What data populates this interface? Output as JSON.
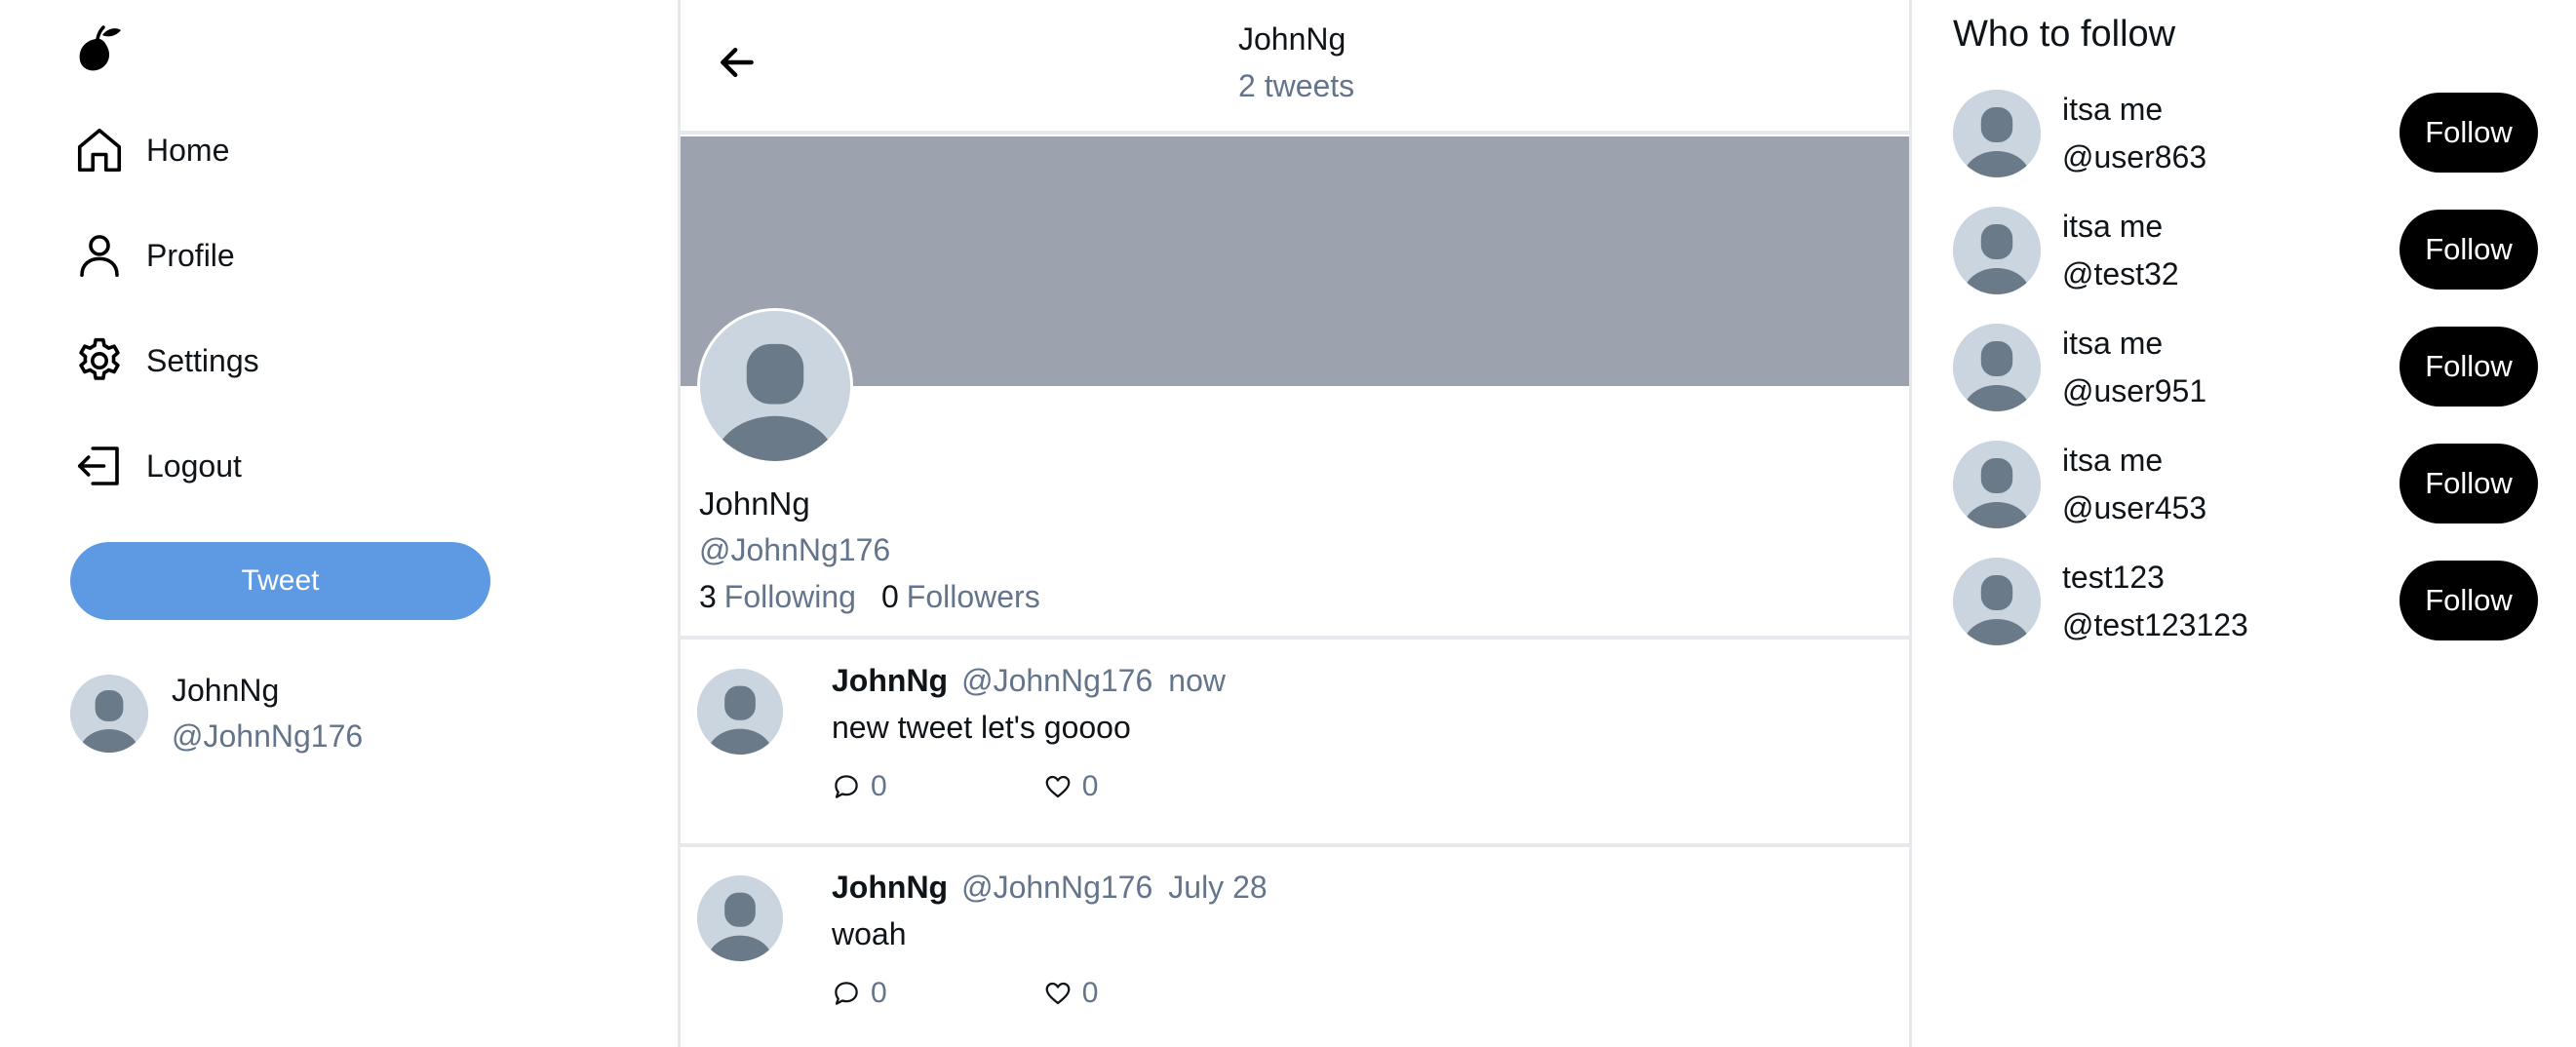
{
  "sidebar": {
    "logo_icon": "pear-logo-icon",
    "nav": [
      {
        "label": "Home",
        "icon": "home-icon"
      },
      {
        "label": "Profile",
        "icon": "user-icon"
      },
      {
        "label": "Settings",
        "icon": "gear-icon"
      },
      {
        "label": "Logout",
        "icon": "logout-icon"
      }
    ],
    "tweet_button": "Tweet",
    "current_user": {
      "name": "JohnNg",
      "handle": "@JohnNg176"
    }
  },
  "header": {
    "name": "JohnNg",
    "tweet_count": "2 tweets"
  },
  "profile": {
    "name": "JohnNg",
    "handle": "@JohnNg176",
    "following_count": "3",
    "following_label": "Following",
    "followers_count": "0",
    "followers_label": "Followers"
  },
  "tweets": [
    {
      "name": "JohnNg",
      "handle": "@JohnNg176",
      "time": "now",
      "text": "new tweet let's goooo",
      "replies": "0",
      "likes": "0"
    },
    {
      "name": "JohnNg",
      "handle": "@JohnNg176",
      "time": "July 28",
      "text": "woah",
      "replies": "0",
      "likes": "0"
    }
  ],
  "who_to_follow": {
    "title": "Who to follow",
    "button_label": "Follow",
    "users": [
      {
        "name": "itsa me",
        "handle": "@user863"
      },
      {
        "name": "itsa me",
        "handle": "@test32"
      },
      {
        "name": "itsa me",
        "handle": "@user951"
      },
      {
        "name": "itsa me",
        "handle": "@user453"
      },
      {
        "name": "test123",
        "handle": "@test123123"
      }
    ]
  },
  "colors": {
    "accent": "#5e99e4",
    "banner": "#9ca3ae",
    "muted_text": "#64748b",
    "follow_button": "#000000",
    "avatar_bg": "#cbd5e0",
    "avatar_fg": "#6b7a89"
  }
}
